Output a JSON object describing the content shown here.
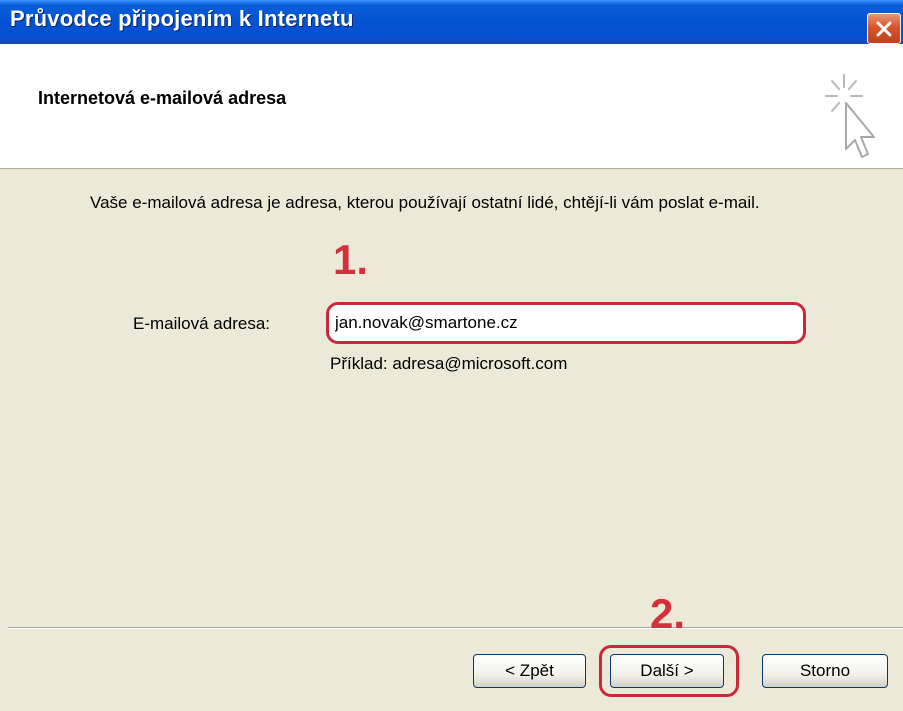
{
  "window": {
    "title": "Průvodce připojením k Internetu"
  },
  "header": {
    "title": "Internetová e-mailová adresa",
    "icon": "wizard-cursor-icon"
  },
  "body": {
    "description": "Vaše e-mailová adresa je adresa, kterou používají ostatní lidé, chtějí-li vám poslat e-mail."
  },
  "annotations": {
    "step1": "1.",
    "step2": "2."
  },
  "form": {
    "email_label": "E-mailová adresa:",
    "email_value": "jan.novak@smartone.cz",
    "example": "Příklad: adresa@microsoft.com"
  },
  "buttons": {
    "back": "< Zpět",
    "next": "Další >",
    "cancel": "Storno"
  },
  "colors": {
    "titlebar": "#0453d4",
    "annotation": "#d3303c",
    "dialog_bg": "#ece9d8"
  }
}
